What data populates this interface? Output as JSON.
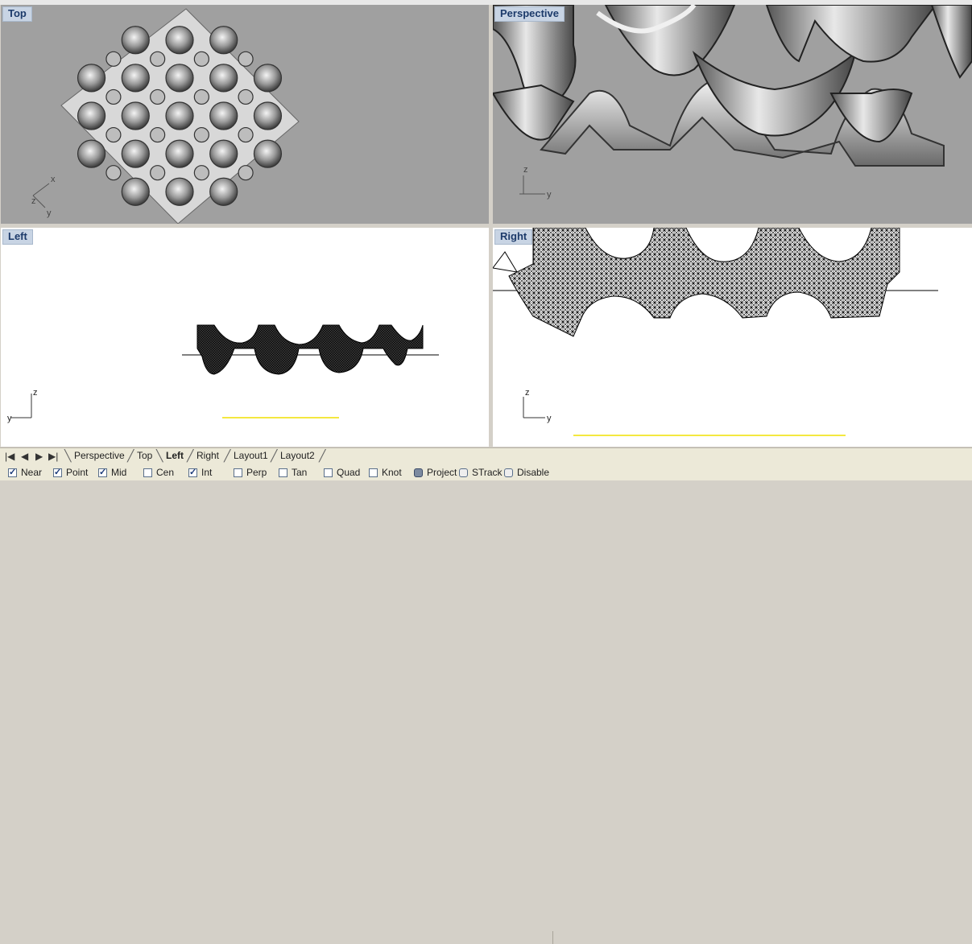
{
  "viewports": {
    "top": {
      "title": "Top",
      "axes": {
        "a": "x",
        "b": "y",
        "c": "z"
      }
    },
    "perspective": {
      "title": "Perspective",
      "axes": {
        "a": "z",
        "b": "y"
      }
    },
    "left": {
      "title": "Left",
      "axes": {
        "a": "z",
        "b": "y"
      }
    },
    "right": {
      "title": "Right",
      "axes": {
        "a": "z",
        "b": "y"
      }
    }
  },
  "tabs": {
    "nav": {
      "first": "|◀",
      "prev": "◀",
      "next": "▶",
      "last": "▶|"
    },
    "items": [
      "Perspective",
      "Top",
      "Left",
      "Right",
      "Layout1",
      "Layout2"
    ],
    "active": "Left"
  },
  "osnaps": [
    {
      "label": "Near",
      "checked": true
    },
    {
      "label": "Point",
      "checked": true
    },
    {
      "label": "Mid",
      "checked": true
    },
    {
      "label": "Cen",
      "checked": false
    },
    {
      "label": "Int",
      "checked": true
    },
    {
      "label": "Perp",
      "checked": false
    },
    {
      "label": "Tan",
      "checked": false
    },
    {
      "label": "Quad",
      "checked": false
    },
    {
      "label": "Knot",
      "checked": false
    },
    {
      "label": "Project",
      "checked": true
    },
    {
      "label": "STrack",
      "checked": false
    },
    {
      "label": "Disable",
      "checked": false
    }
  ],
  "colors": {
    "viewport_shaded": "#a0a0a0",
    "viewport_wire": "#ffffff",
    "construction_line": "#f0e000",
    "title_bg": "#c8d4e4"
  }
}
